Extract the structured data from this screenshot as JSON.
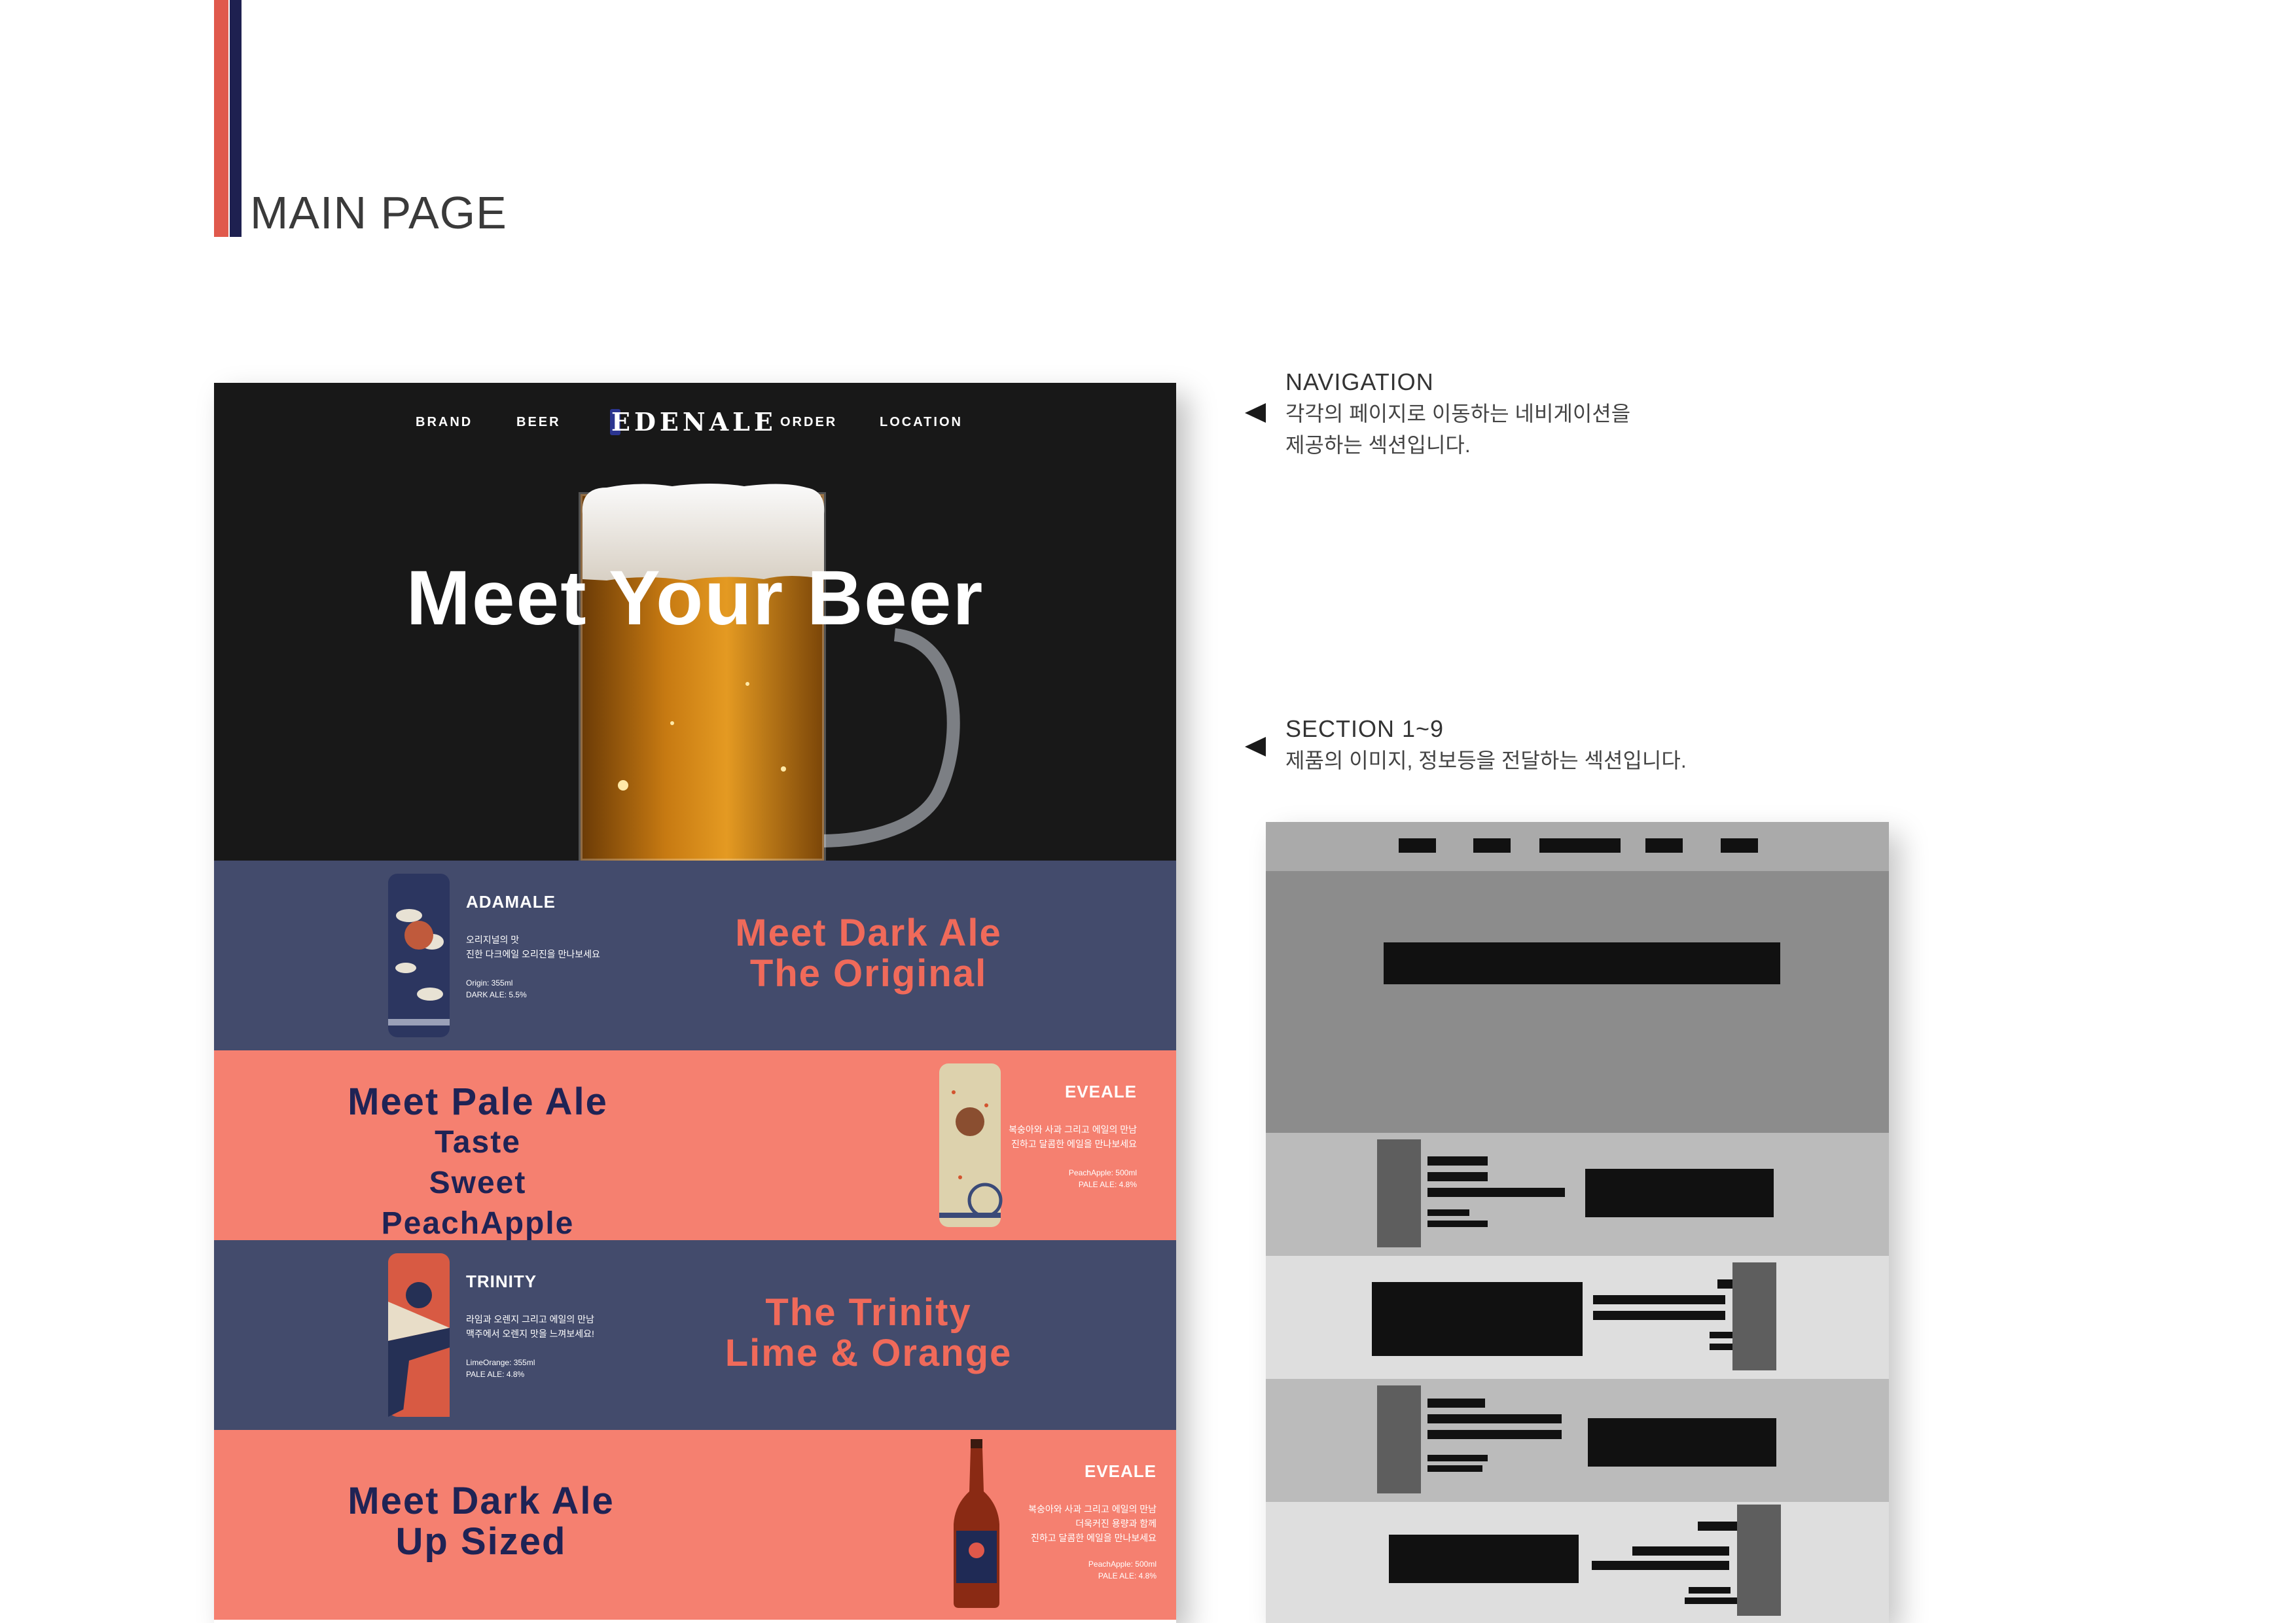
{
  "page_title": "MAIN PAGE",
  "colors": {
    "accent_red": "#e0594c",
    "accent_navy": "#1e2050",
    "band_navy": "#434b6c",
    "band_coral": "#f58070"
  },
  "site": {
    "nav": {
      "brand": "BRAND",
      "beer": "BEER",
      "logo": "EDENALE",
      "order": "ORDER",
      "location": "LOCATION"
    },
    "hero_title": "Meet Your Beer",
    "sections": [
      {
        "brand": "ADAMALE",
        "desc": [
          "오리지널의 맛",
          "진한 다크에일 오리진을 만나보세요"
        ],
        "specs": [
          "Origin: 355ml",
          "DARK ALE: 5.5%"
        ],
        "headline": [
          "Meet Dark Ale",
          "The Original"
        ]
      },
      {
        "brand": "EVEALE",
        "desc": [
          "복숭아와 사과 그리고 에일의 만남",
          "진하고 달콤한 에일을 만나보세요"
        ],
        "specs": [
          "PeachApple: 500ml",
          "PALE ALE: 4.8%"
        ],
        "headline": [
          "Meet Pale Ale",
          "Taste",
          "Sweet PeachApple"
        ]
      },
      {
        "brand": "TRINITY",
        "desc": [
          "라임과 오렌지 그리고 에일의 만남",
          "맥주에서 오렌지 맛을 느껴보세요!"
        ],
        "specs": [
          "LimeOrange: 355ml",
          "PALE ALE: 4.8%"
        ],
        "headline": [
          "The Trinity",
          "Lime & Orange"
        ]
      },
      {
        "brand": "EVEALE",
        "desc": [
          "복숭아와 사과 그리고 에일의 만남",
          "더욱커진 용량과 함께",
          "진하고 달콤한 에일을 만나보세요"
        ],
        "specs": [
          "PeachApple: 500ml",
          "PALE ALE: 4.8%"
        ],
        "headline": [
          "Meet Dark Ale",
          "Up Sized"
        ]
      }
    ]
  },
  "annotations": {
    "navigation": {
      "title": "NAVIGATION",
      "lines": [
        "각각의 페이지로 이동하는 네비게이션을",
        "제공하는 섹션입니다."
      ]
    },
    "sections": {
      "title": "SECTION 1~9",
      "lines": [
        "제품의 이미지, 정보등을 전달하는 섹션입니다."
      ]
    }
  }
}
